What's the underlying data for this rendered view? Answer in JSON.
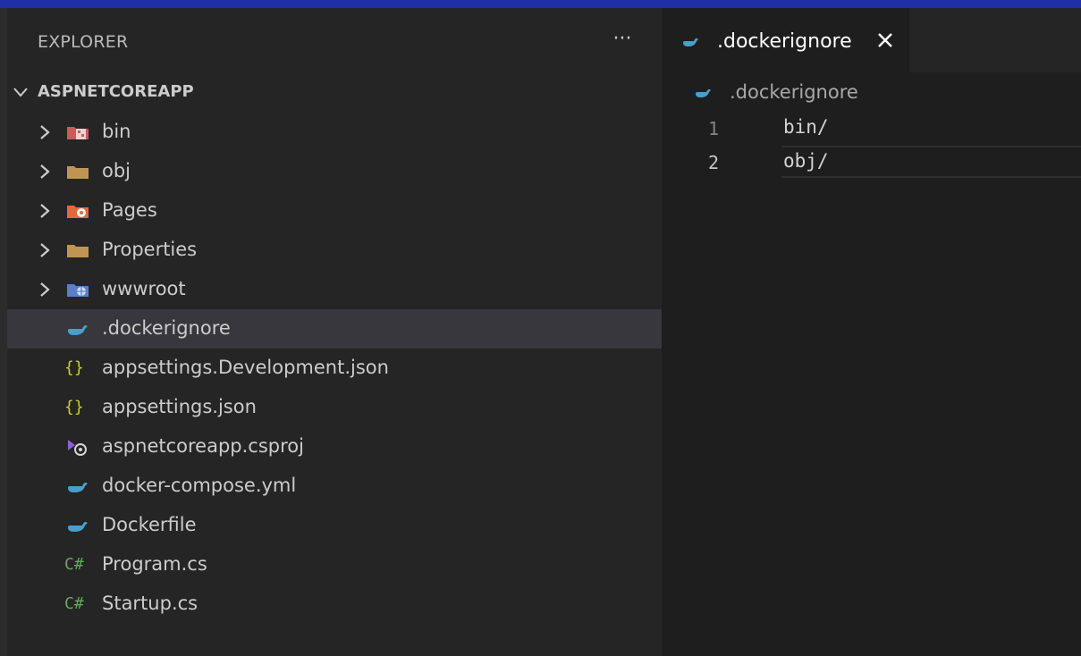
{
  "colors": {
    "top_accent": "#1f2fa6",
    "sidebar_bg": "#252526",
    "editor_bg": "#1e1e1e",
    "selected_row": "#37373d",
    "docker_blue": "#4a9fc8",
    "json_yellow": "#cbcb41",
    "csharp_green": "#5fad56"
  },
  "explorer": {
    "title": "EXPLORER",
    "more_actions": "···",
    "project_name": "ASPNETCOREAPP"
  },
  "tree": [
    {
      "label": "bin",
      "kind": "folder",
      "icon": "folder-bin-icon"
    },
    {
      "label": "obj",
      "kind": "folder",
      "icon": "folder-icon"
    },
    {
      "label": "Pages",
      "kind": "folder",
      "icon": "folder-pages-icon"
    },
    {
      "label": "Properties",
      "kind": "folder",
      "icon": "folder-icon"
    },
    {
      "label": "wwwroot",
      "kind": "folder",
      "icon": "folder-www-icon"
    },
    {
      "label": ".dockerignore",
      "kind": "file",
      "icon": "docker-icon",
      "selected": true
    },
    {
      "label": "appsettings.Development.json",
      "kind": "file",
      "icon": "json-icon",
      "icon_text": "{}"
    },
    {
      "label": "appsettings.json",
      "kind": "file",
      "icon": "json-icon",
      "icon_text": "{}"
    },
    {
      "label": "aspnetcoreapp.csproj",
      "kind": "file",
      "icon": "csproj-icon"
    },
    {
      "label": "docker-compose.yml",
      "kind": "file",
      "icon": "docker-icon"
    },
    {
      "label": "Dockerfile",
      "kind": "file",
      "icon": "docker-icon"
    },
    {
      "label": "Program.cs",
      "kind": "file",
      "icon": "csharp-icon",
      "icon_text": "C#"
    },
    {
      "label": "Startup.cs",
      "kind": "file",
      "icon": "csharp-icon",
      "icon_text": "C#"
    }
  ],
  "tab": {
    "label": ".dockerignore",
    "icon": "docker-icon",
    "close": "close-icon"
  },
  "breadcrumb": {
    "label": ".dockerignore"
  },
  "editor": {
    "lines": [
      {
        "number": "1",
        "text": "bin/"
      },
      {
        "number": "2",
        "text": "obj/"
      }
    ]
  }
}
